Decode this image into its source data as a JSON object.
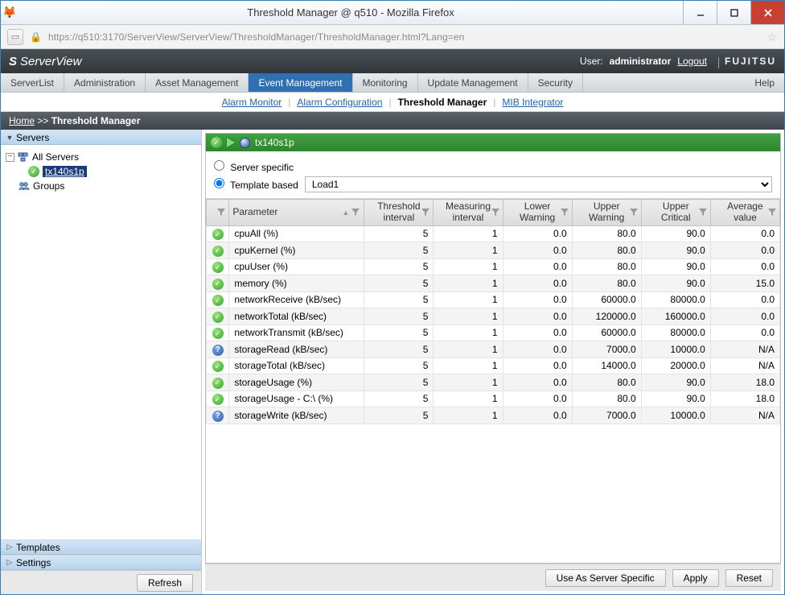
{
  "window": {
    "title": "Threshold Manager @ q510 - Mozilla Firefox",
    "url": "https://q510:3170/ServerView/ServerView/ThresholdManager/ThresholdManager.html?Lang=en"
  },
  "brand": {
    "product": "ServerView",
    "user_label": "User:",
    "user": "administrator",
    "logout": "Logout",
    "vendor": "FUJITSU"
  },
  "tabs": {
    "items": [
      "ServerList",
      "Administration",
      "Asset Management",
      "Event Management",
      "Monitoring",
      "Update Management",
      "Security"
    ],
    "active_index": 3,
    "help": "Help"
  },
  "subnav": {
    "items": [
      "Alarm Monitor",
      "Alarm Configuration",
      "Threshold Manager",
      "MIB Integrator"
    ],
    "active_index": 2
  },
  "breadcrumb": {
    "home": "Home",
    "sep": ">>",
    "current": "Threshold Manager"
  },
  "left": {
    "panels": {
      "servers": "Servers",
      "templates": "Templates",
      "settings": "Settings"
    },
    "tree": {
      "all_servers": "All Servers",
      "selected": "tx140s1p",
      "groups": "Groups"
    },
    "refresh": "Refresh"
  },
  "context": {
    "server": "tx140s1p"
  },
  "mode": {
    "server_specific": "Server specific",
    "template_based": "Template based",
    "selected": "template",
    "template_value": "Load1"
  },
  "columns": [
    "Parameter",
    "Threshold interval",
    "Measuring interval",
    "Lower Warning",
    "Upper Warning",
    "Upper Critical",
    "Average value"
  ],
  "rows": [
    {
      "status": "ok",
      "param": "cpuAll (%)",
      "ti": "5",
      "mi": "1",
      "lw": "0.0",
      "uw": "80.0",
      "uc": "90.0",
      "av": "0.0"
    },
    {
      "status": "ok",
      "param": "cpuKernel (%)",
      "ti": "5",
      "mi": "1",
      "lw": "0.0",
      "uw": "80.0",
      "uc": "90.0",
      "av": "0.0"
    },
    {
      "status": "ok",
      "param": "cpuUser (%)",
      "ti": "5",
      "mi": "1",
      "lw": "0.0",
      "uw": "80.0",
      "uc": "90.0",
      "av": "0.0"
    },
    {
      "status": "ok",
      "param": "memory (%)",
      "ti": "5",
      "mi": "1",
      "lw": "0.0",
      "uw": "80.0",
      "uc": "90.0",
      "av": "15.0"
    },
    {
      "status": "ok",
      "param": "networkReceive (kB/sec)",
      "ti": "5",
      "mi": "1",
      "lw": "0.0",
      "uw": "60000.0",
      "uc": "80000.0",
      "av": "0.0"
    },
    {
      "status": "ok",
      "param": "networkTotal (kB/sec)",
      "ti": "5",
      "mi": "1",
      "lw": "0.0",
      "uw": "120000.0",
      "uc": "160000.0",
      "av": "0.0"
    },
    {
      "status": "ok",
      "param": "networkTransmit (kB/sec)",
      "ti": "5",
      "mi": "1",
      "lw": "0.0",
      "uw": "60000.0",
      "uc": "80000.0",
      "av": "0.0"
    },
    {
      "status": "info",
      "param": "storageRead (kB/sec)",
      "ti": "5",
      "mi": "1",
      "lw": "0.0",
      "uw": "7000.0",
      "uc": "10000.0",
      "av": "N/A"
    },
    {
      "status": "ok",
      "param": "storageTotal (kB/sec)",
      "ti": "5",
      "mi": "1",
      "lw": "0.0",
      "uw": "14000.0",
      "uc": "20000.0",
      "av": "N/A"
    },
    {
      "status": "ok",
      "param": "storageUsage (%)",
      "ti": "5",
      "mi": "1",
      "lw": "0.0",
      "uw": "80.0",
      "uc": "90.0",
      "av": "18.0"
    },
    {
      "status": "ok",
      "param": "storageUsage - C:\\ (%)",
      "ti": "5",
      "mi": "1",
      "lw": "0.0",
      "uw": "80.0",
      "uc": "90.0",
      "av": "18.0"
    },
    {
      "status": "info",
      "param": "storageWrite (kB/sec)",
      "ti": "5",
      "mi": "1",
      "lw": "0.0",
      "uw": "7000.0",
      "uc": "10000.0",
      "av": "N/A"
    }
  ],
  "footer": {
    "use_as_server_specific": "Use As Server Specific",
    "apply": "Apply",
    "reset": "Reset"
  }
}
